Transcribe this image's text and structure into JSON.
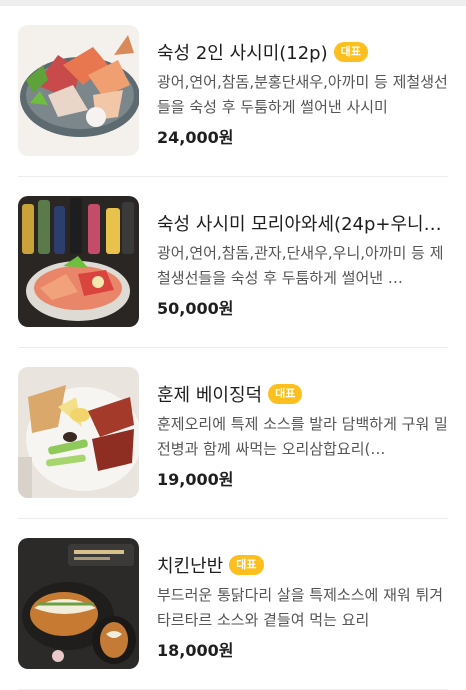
{
  "menu": {
    "items": [
      {
        "name": "숙성 2인 사시미(12p)",
        "badge": "대표",
        "description": "광어,연어,참돔,분홍단새우,아까미 등 제철생선들을 숙성 후 두툼하게 썰어낸 사시미",
        "price": "24,000원",
        "image_icon": "sashimi-platter-photo"
      },
      {
        "name": "숙성 사시미 모리아와세(24p+우니…",
        "badge": "",
        "description": "광어,연어,참돔,관자,단새우,우니,아까미 등 제철생선들을 숙성 후 두툼하게 썰어낸 …",
        "price": "50,000원",
        "image_icon": "sashimi-with-drinks-photo"
      },
      {
        "name": "훈제 베이징덕",
        "badge": "대표",
        "description": "훈제오리에 특제 소스를 발라 담백하게 구워 밀전병과 함께 싸먹는 오리삼합요리(…",
        "price": "19,000원",
        "image_icon": "peking-duck-photo"
      },
      {
        "name": "치킨난반",
        "badge": "대표",
        "description": "부드러운 통닭다리 살을 특제소스에 재워 튀겨 타르타르 소스와 곁들여 먹는 요리",
        "price": "18,000원",
        "image_icon": "chicken-nanban-photo"
      }
    ]
  },
  "colors": {
    "badge": "#fcbf1e",
    "text": "#1e1e1e",
    "desc": "#555555",
    "divider": "#ececec"
  }
}
